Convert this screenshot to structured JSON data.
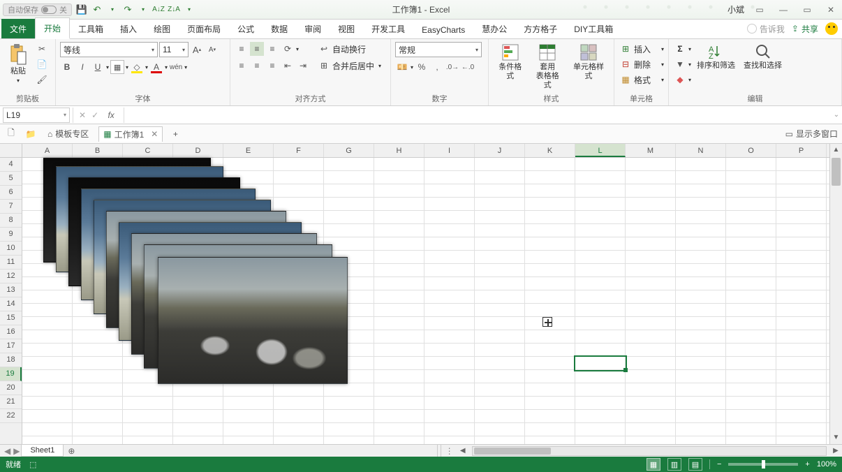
{
  "titlebar": {
    "autosave": "自动保存",
    "autosave_state": "关",
    "title": "工作簿1 - Excel",
    "user": "小斌"
  },
  "qat": {
    "save": "💾",
    "undo": "↶",
    "redo": "↷",
    "sort_asc": "A↓Z",
    "sort_desc": "Z↓A",
    "custom": "▾"
  },
  "window": {
    "min": "—",
    "restore": "▭",
    "close": "✕",
    "ribbon_opts": "▭"
  },
  "tabs": {
    "file": "文件",
    "home": "开始",
    "toolkit": "工具箱",
    "insert": "插入",
    "draw": "绘图",
    "layout": "页面布局",
    "formula": "公式",
    "data": "数据",
    "review": "审阅",
    "view": "视图",
    "developer": "开发工具",
    "easycharts": "EasyCharts",
    "huiban": "慧办公",
    "fgz": "方方格子",
    "diy": "DIY工具箱",
    "tellme": "告诉我",
    "share": "共享"
  },
  "ribbon": {
    "clipboard": {
      "label": "剪贴板",
      "paste": "粘贴",
      "cut": "✂",
      "copy": "📄",
      "painter": "🖌"
    },
    "font": {
      "label": "字体",
      "name": "等线",
      "size": "11",
      "grow": "A",
      "shrink": "A",
      "bold": "B",
      "italic": "I",
      "underline": "U",
      "ruby": "wén"
    },
    "align": {
      "label": "对齐方式",
      "wrap": "自动换行",
      "merge": "合并后居中"
    },
    "number": {
      "label": "数字",
      "format": "常规",
      "currency": "💴",
      "percent": "%",
      "comma": ",",
      "inc": "⁰₀",
      "dec": "₀⁰"
    },
    "styles": {
      "label": "样式",
      "cond": "条件格式",
      "table": "套用\n表格格式",
      "cell": "单元格样式"
    },
    "cells": {
      "label": "单元格",
      "insert": "插入",
      "delete": "删除",
      "format": "格式"
    },
    "editing": {
      "label": "编辑",
      "sort": "排序和筛选",
      "find": "查找和选择"
    }
  },
  "fbar": {
    "cell": "L19",
    "fx": "fx"
  },
  "doctabs": {
    "template": "模板专区",
    "workbook": "工作簿1",
    "add": "+",
    "multiview": "显示多窗口"
  },
  "columns": [
    "A",
    "B",
    "C",
    "D",
    "E",
    "F",
    "G",
    "H",
    "I",
    "J",
    "K",
    "L",
    "M",
    "N",
    "O",
    "P"
  ],
  "rows": [
    "4",
    "5",
    "6",
    "7",
    "8",
    "9",
    "10",
    "11",
    "12",
    "13",
    "14",
    "15",
    "16",
    "17",
    "18",
    "19",
    "20",
    "21",
    "22"
  ],
  "selected": {
    "col": "L",
    "row": "19"
  },
  "sheettabs": {
    "sheet1": "Sheet1"
  },
  "status": {
    "ready": "就绪",
    "accessibility": "⬚",
    "zoom": "100%",
    "minus": "−",
    "plus": "+"
  }
}
